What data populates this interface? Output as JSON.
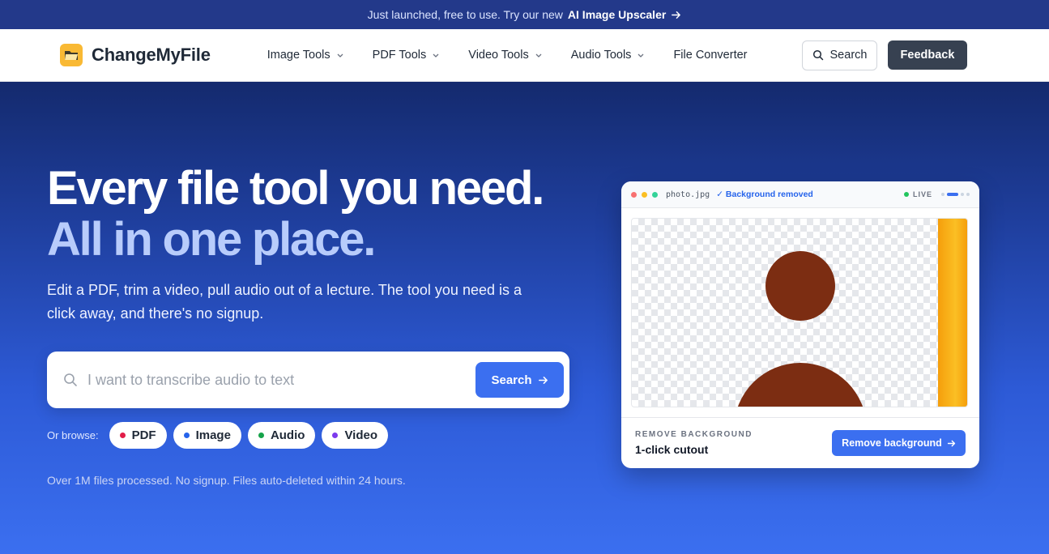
{
  "banner": {
    "text": "Just launched, free to use. Try our new",
    "link_label": "AI Image Upscaler"
  },
  "nav": {
    "brand": "ChangeMyFile",
    "menu": [
      {
        "label": "Image Tools",
        "dropdown": true
      },
      {
        "label": "PDF Tools",
        "dropdown": true
      },
      {
        "label": "Video Tools",
        "dropdown": true
      },
      {
        "label": "Audio Tools",
        "dropdown": true
      },
      {
        "label": "File Converter",
        "dropdown": false
      }
    ],
    "search_label": "Search",
    "feedback_label": "Feedback"
  },
  "hero": {
    "headline_1": "Every file tool you need.",
    "headline_2": "All in one place.",
    "subcopy": "Edit a PDF, trim a video, pull audio out of a lecture. The tool you need is a click away, and there's no signup.",
    "search": {
      "placeholder": "I want to transcribe audio to text",
      "value": "",
      "button_label": "Search"
    },
    "browse_label": "Or browse:",
    "browse_pills": [
      {
        "label": "PDF",
        "dot_color": "#e11d48"
      },
      {
        "label": "Image",
        "dot_color": "#2563eb"
      },
      {
        "label": "Audio",
        "dot_color": "#16a34a"
      },
      {
        "label": "Video",
        "dot_color": "#7c3aed"
      }
    ],
    "footnote": "Over 1M files processed. No signup. Files auto-deleted within 24 hours."
  },
  "preview_card": {
    "window_dots": [
      "#f87171",
      "#fbbf24",
      "#34d399"
    ],
    "filename": "photo.jpg",
    "status": "✓ Background removed",
    "live_label": "LIVE",
    "footer_kicker": "REMOVE BACKGROUND",
    "footer_title": "1-click cutout",
    "action_label": "Remove background"
  },
  "colors": {
    "accent": "#3b6ff0",
    "banner_bg": "#23398a",
    "feedback_bg": "#374151",
    "subject": "#7c2d12"
  }
}
